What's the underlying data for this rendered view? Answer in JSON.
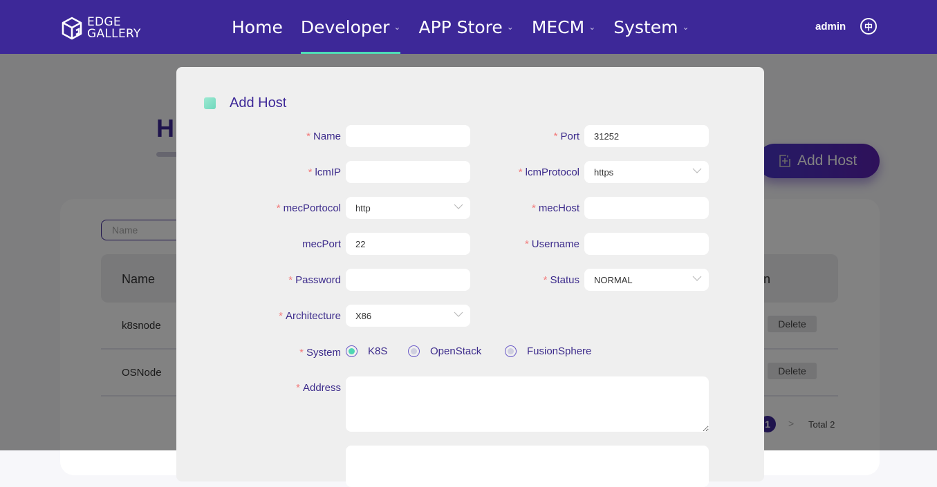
{
  "header": {
    "logo_line1": "EDGE",
    "logo_line2": "GALLERY",
    "nav": [
      {
        "label": "Home",
        "dropdown": false
      },
      {
        "label": "Developer",
        "dropdown": true,
        "active": true
      },
      {
        "label": "APP Store",
        "dropdown": true
      },
      {
        "label": "MECM",
        "dropdown": true
      },
      {
        "label": "System",
        "dropdown": true
      }
    ],
    "user": "admin",
    "language_icon": "中"
  },
  "background": {
    "title_partial": "H",
    "add_host_button": "Add Host",
    "search_placeholder": "Name",
    "table": {
      "header_first": "Name",
      "header_last_partial": "n",
      "rows": [
        {
          "name": "k8snode",
          "action": "Delete"
        },
        {
          "name": "OSNode",
          "action": "Delete"
        }
      ]
    },
    "pagination": {
      "current": "1",
      "next": ">",
      "total": "Total 2"
    }
  },
  "modal": {
    "title": "Add Host",
    "left": [
      {
        "label": "Name",
        "required": true,
        "value": "",
        "type": "input"
      },
      {
        "label": "lcmIP",
        "required": true,
        "value": "",
        "type": "input"
      },
      {
        "label": "mecPortocol",
        "required": true,
        "value": "http",
        "type": "select"
      },
      {
        "label": "mecPort",
        "required": false,
        "value": "22",
        "type": "input"
      },
      {
        "label": "Password",
        "required": true,
        "value": "",
        "type": "input"
      },
      {
        "label": "Architecture",
        "required": true,
        "value": "X86",
        "type": "select"
      }
    ],
    "right": [
      {
        "label": "Port",
        "required": true,
        "value": "31252",
        "type": "input"
      },
      {
        "label": "lcmProtocol",
        "required": true,
        "value": "https",
        "type": "select"
      },
      {
        "label": "mecHost",
        "required": true,
        "value": "",
        "type": "input"
      },
      {
        "label": "Username",
        "required": true,
        "value": "",
        "type": "input"
      },
      {
        "label": "Status",
        "required": true,
        "value": "NORMAL",
        "type": "select"
      }
    ],
    "system": {
      "label": "System",
      "options": [
        "K8S",
        "OpenStack",
        "FusionSphere"
      ],
      "selected": "K8S"
    },
    "address": {
      "label": "Address",
      "value": ""
    }
  },
  "colors": {
    "header": "#3d2898",
    "accent": "#4fd6b2",
    "required": "#f27c7c"
  }
}
